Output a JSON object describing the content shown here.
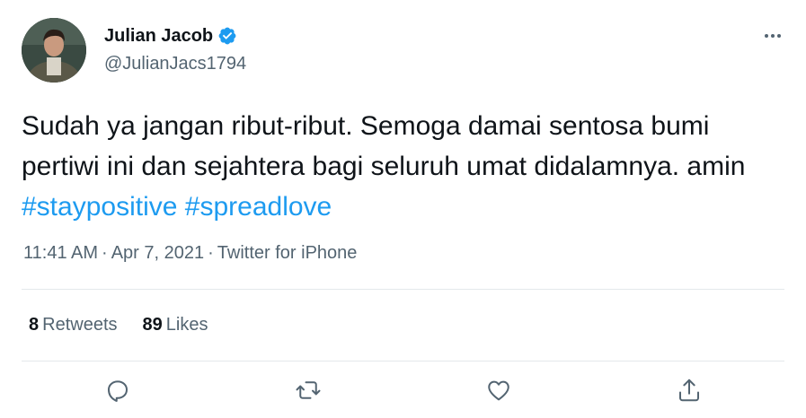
{
  "author": {
    "display_name": "Julian Jacob",
    "handle": "@JulianJacs1794",
    "verified": true
  },
  "tweet": {
    "text_plain": "Sudah ya jangan ribut-ribut. Semoga damai sentosa bumi pertiwi ini dan sejahtera bagi seluruh umat didalamnya. amin ",
    "hashtags": [
      "#staypositive",
      "#spreadlove"
    ]
  },
  "meta": {
    "time": "11:41 AM",
    "date": "Apr 7, 2021",
    "source": "Twitter for iPhone",
    "separator": "·"
  },
  "stats": {
    "retweets_count": "8",
    "retweets_label": "Retweets",
    "likes_count": "89",
    "likes_label": "Likes"
  },
  "icons": {
    "more": "more-icon",
    "verified": "verified-badge-icon",
    "reply": "reply-icon",
    "retweet": "retweet-icon",
    "like": "heart-icon",
    "share": "share-icon"
  },
  "colors": {
    "accent": "#1d9bf0",
    "text": "#0f1419",
    "secondary": "#536471",
    "divider": "#e4e8eb"
  }
}
